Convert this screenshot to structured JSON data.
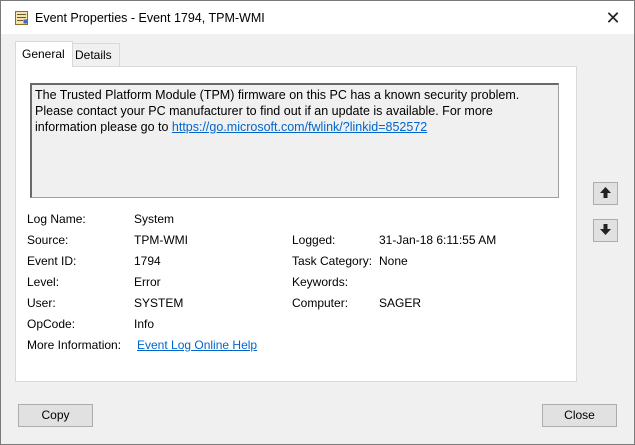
{
  "window": {
    "title": "Event Properties - Event 1794, TPM-WMI",
    "close_glyph": "✕"
  },
  "tabs": [
    {
      "label": "General",
      "active": true
    },
    {
      "label": "Details",
      "active": false
    }
  ],
  "description": {
    "text": "The Trusted Platform Module (TPM) firmware on this PC has a known security problem. Please contact your PC manufacturer to find out if an update is available. For more information please go to ",
    "link": "https://go.microsoft.com/fwlink/?linkid=852572"
  },
  "fields": {
    "log_name": {
      "label": "Log Name:",
      "value": "System"
    },
    "source": {
      "label": "Source:",
      "value": "TPM-WMI"
    },
    "event_id": {
      "label": "Event ID:",
      "value": "1794"
    },
    "level": {
      "label": "Level:",
      "value": "Error"
    },
    "user": {
      "label": "User:",
      "value": "SYSTEM"
    },
    "opcode": {
      "label": "OpCode:",
      "value": "Info"
    },
    "more_info": {
      "label": "More Information:",
      "value": "Event Log Online Help"
    },
    "logged": {
      "label": "Logged:",
      "value": "31-Jan-18 6:11:55 AM"
    },
    "task_category": {
      "label": "Task Category:",
      "value": "None"
    },
    "keywords": {
      "label": "Keywords:",
      "value": ""
    },
    "computer": {
      "label": "Computer:",
      "value": "SAGER"
    }
  },
  "buttons": {
    "copy": "Copy",
    "close": "Close"
  },
  "icons": {
    "up": "arrow-up-icon",
    "down": "arrow-down-icon",
    "title": "event-viewer-icon"
  }
}
